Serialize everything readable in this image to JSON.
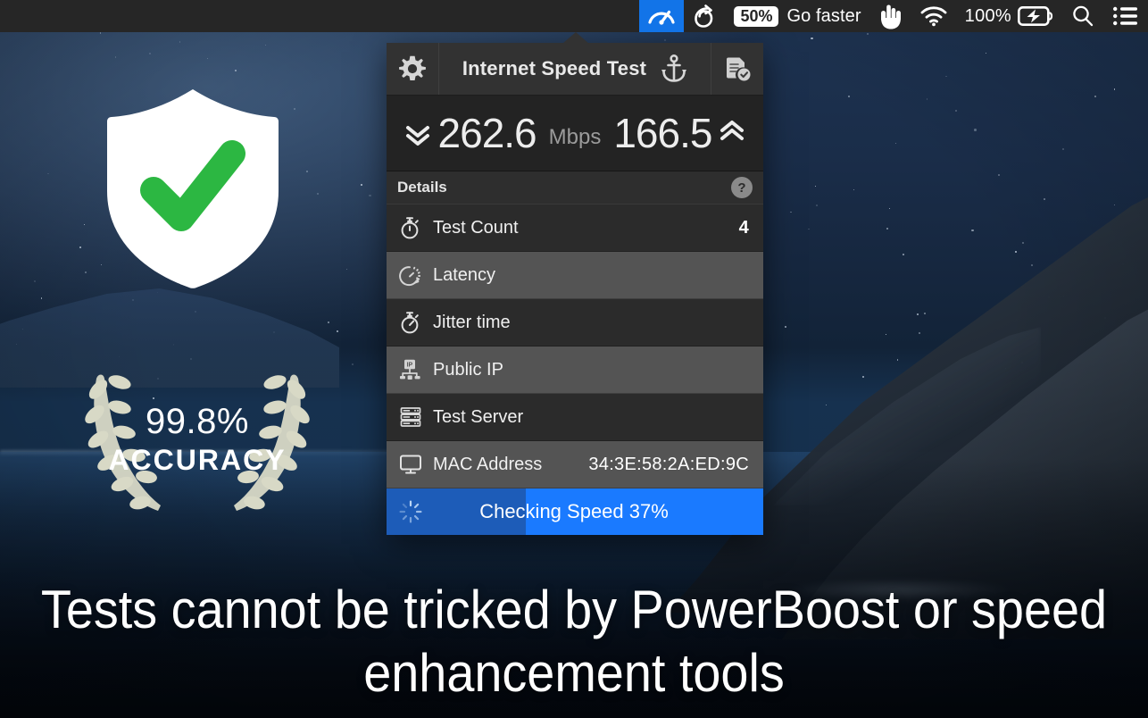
{
  "menubar": {
    "items": [
      {
        "name": "speedtest-menu-icon",
        "icon": "speedometer-icon",
        "label": "",
        "active": true
      },
      {
        "name": "clip-menu-icon",
        "icon": "link-loop-icon",
        "label": "",
        "active": false
      },
      {
        "name": "go-faster-item",
        "icon": "",
        "badge": "50%",
        "label": "Go faster",
        "active": false
      },
      {
        "name": "hand-menu-icon",
        "icon": "rock-hand-icon",
        "label": "",
        "active": false
      },
      {
        "name": "wifi-menu-icon",
        "icon": "wifi-icon",
        "label": "",
        "active": false
      },
      {
        "name": "battery-menu-item",
        "icon": "battery-charging-icon",
        "label": "100%",
        "active": false
      },
      {
        "name": "spotlight-menu-icon",
        "icon": "search-icon",
        "label": "",
        "active": false
      },
      {
        "name": "control-center-menu-icon",
        "icon": "list-icon",
        "label": "",
        "active": false
      }
    ],
    "battery_percent": "100%",
    "go_faster_badge": "50%",
    "go_faster_label": "Go faster"
  },
  "desktop": {
    "shield_alt": "shield-check-icon",
    "accuracy_percent": "99.8%",
    "accuracy_label": "ACCURACY",
    "caption_line1": "Tests cannot be tricked by PowerBoost or speed",
    "caption_line2": "enhancement tools"
  },
  "popover": {
    "header": {
      "settings_icon": "gear-icon",
      "title": "Internet Speed Test",
      "pin_icon": "anchor-icon",
      "report_icon": "report-check-icon"
    },
    "speeds": {
      "download": "262.6",
      "unit": "Mbps",
      "upload": "166.5",
      "download_icon": "chevron-double-down-icon",
      "upload_icon": "chevron-double-up-icon"
    },
    "details": {
      "title": "Details",
      "help_label": "?"
    },
    "rows": [
      {
        "icon": "stopwatch-icon",
        "label": "Test Count",
        "value": "4",
        "shade": "dark"
      },
      {
        "icon": "latency-gauge-icon",
        "label": "Latency",
        "value": "",
        "shade": "light"
      },
      {
        "icon": "jitter-stopwatch-icon",
        "label": "Jitter time",
        "value": "",
        "shade": "dark"
      },
      {
        "icon": "ip-node-icon",
        "label": "Public IP",
        "value": "",
        "shade": "light"
      },
      {
        "icon": "server-rack-icon",
        "label": "Test Server",
        "value": "",
        "shade": "dark"
      },
      {
        "icon": "monitor-icon",
        "label": "MAC Address",
        "value": "34:3E:58:2A:ED:9C",
        "shade": "light"
      }
    ],
    "progress": {
      "icon": "spinner-icon",
      "text": "Checking Speed 37%",
      "percent": 37
    }
  },
  "colors": {
    "accent_blue": "#1a7aff",
    "progress_track": "#1d5cb8",
    "menubar_bg": "#262626",
    "panel_bg": "#2b2b2b",
    "panel_row_alt": "#545454",
    "check_green": "#2cb742",
    "highlight_blue": "#1274e8"
  }
}
